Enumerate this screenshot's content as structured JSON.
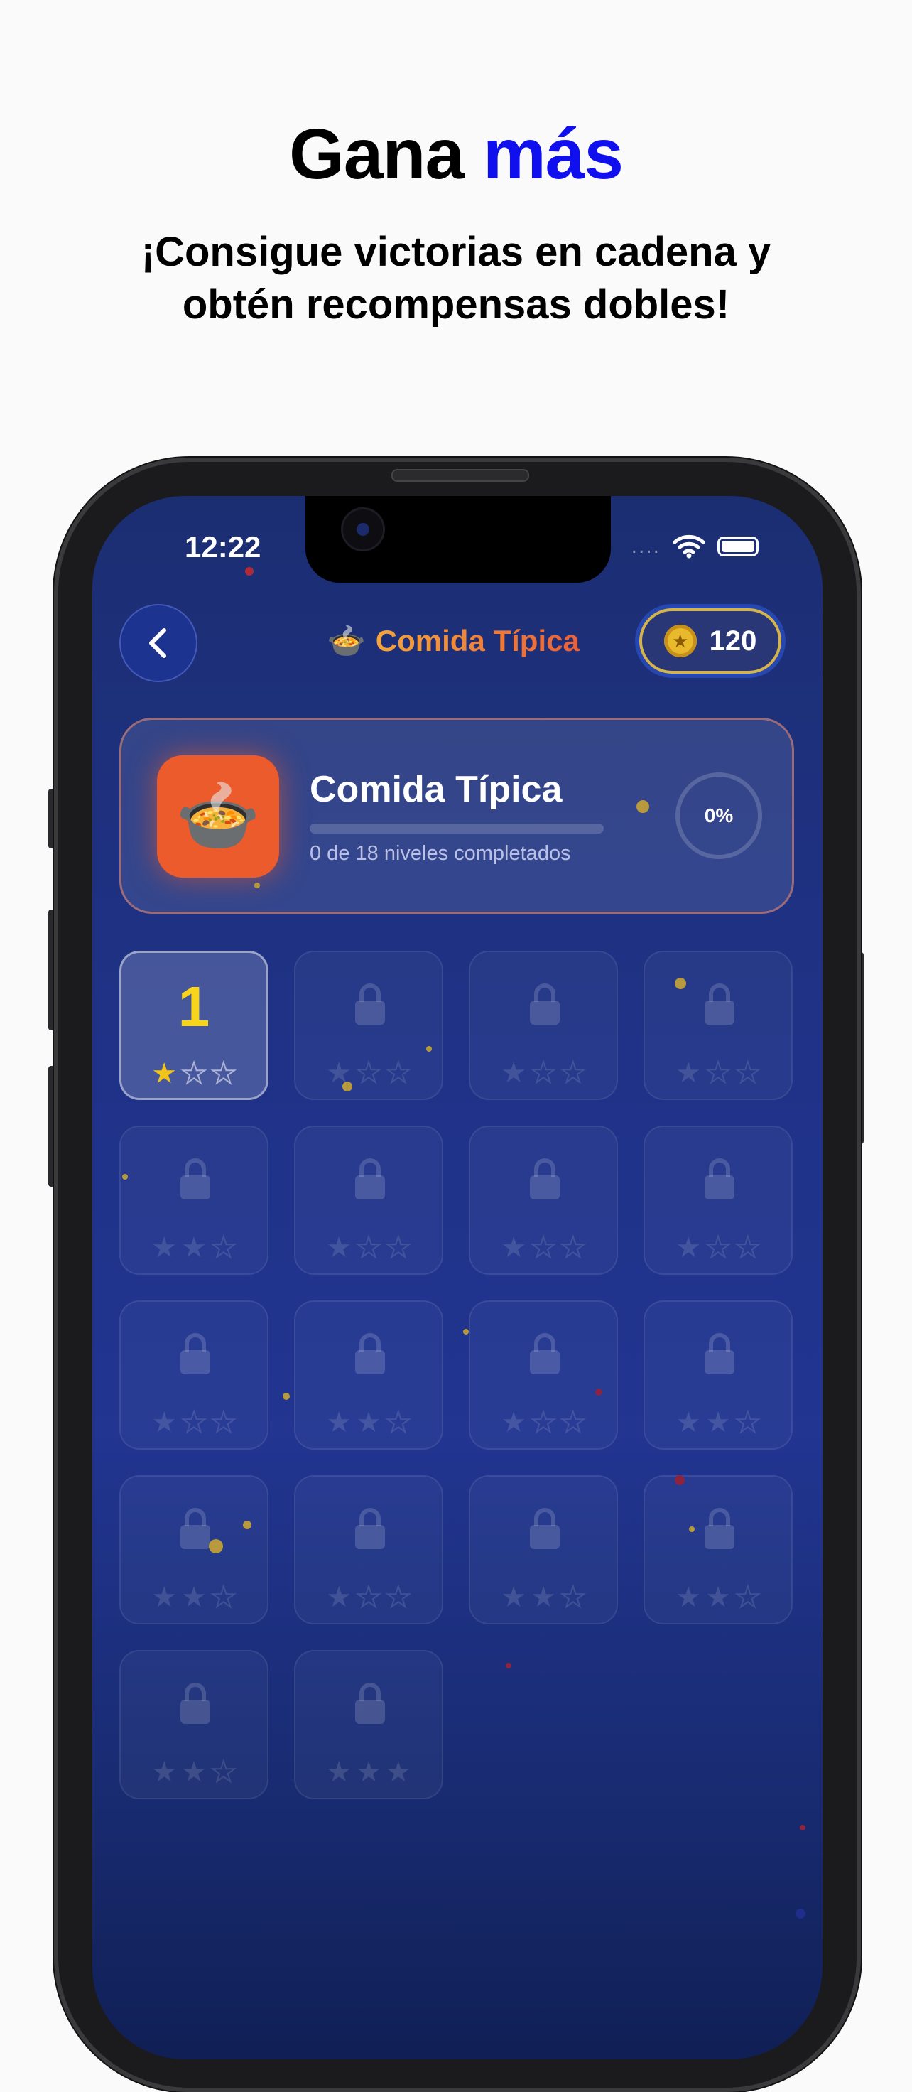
{
  "promo": {
    "headline_main": "Gana",
    "headline_accent": "más",
    "subline_1": "¡Consigue victorias en cadena y",
    "subline_2": "obtén recompensas dobles!"
  },
  "status_bar": {
    "time": "12:22",
    "signal_dots": "....",
    "wifi_icon": "wifi-icon",
    "battery_icon": "battery-icon"
  },
  "nav": {
    "back_icon": "chevron-left-icon",
    "title_emoji": "🍲",
    "title": "Comida Típica",
    "coins": "120"
  },
  "category": {
    "emoji": "🍲",
    "name": "Comida Típica",
    "progress_text": "0 de 18 niveles completados",
    "progress_percent": "0%",
    "progress_fraction": 0
  },
  "levels": [
    {
      "label": "1",
      "locked": false,
      "stars": [
        "on",
        "empty",
        "empty"
      ]
    },
    {
      "label": "",
      "locked": true,
      "stars": [
        "on",
        "empty",
        "empty"
      ]
    },
    {
      "label": "",
      "locked": true,
      "stars": [
        "on",
        "empty",
        "empty"
      ]
    },
    {
      "label": "",
      "locked": true,
      "stars": [
        "on",
        "empty",
        "empty"
      ]
    },
    {
      "label": "",
      "locked": true,
      "stars": [
        "on",
        "on",
        "empty"
      ]
    },
    {
      "label": "",
      "locked": true,
      "stars": [
        "on",
        "empty",
        "empty"
      ]
    },
    {
      "label": "",
      "locked": true,
      "stars": [
        "on",
        "empty",
        "empty"
      ]
    },
    {
      "label": "",
      "locked": true,
      "stars": [
        "on",
        "empty",
        "empty"
      ]
    },
    {
      "label": "",
      "locked": true,
      "stars": [
        "on",
        "empty",
        "empty"
      ]
    },
    {
      "label": "",
      "locked": true,
      "stars": [
        "on",
        "on",
        "empty"
      ]
    },
    {
      "label": "",
      "locked": true,
      "stars": [
        "on",
        "empty",
        "empty"
      ]
    },
    {
      "label": "",
      "locked": true,
      "stars": [
        "on",
        "on",
        "empty"
      ]
    },
    {
      "label": "",
      "locked": true,
      "stars": [
        "on",
        "on",
        "empty"
      ]
    },
    {
      "label": "",
      "locked": true,
      "stars": [
        "on",
        "empty",
        "empty"
      ]
    },
    {
      "label": "",
      "locked": true,
      "stars": [
        "on",
        "on",
        "empty"
      ]
    },
    {
      "label": "",
      "locked": true,
      "stars": [
        "on",
        "on",
        "empty"
      ]
    },
    {
      "label": "",
      "locked": true,
      "stars": [
        "on",
        "on",
        "empty"
      ]
    },
    {
      "label": "",
      "locked": true,
      "stars": [
        "on",
        "on",
        "on"
      ]
    }
  ],
  "colors": {
    "accent_blue": "#1010ee",
    "star_gold": "#f0c419",
    "level_number": "#f7d51d",
    "category_orange": "#ec5b2c"
  }
}
